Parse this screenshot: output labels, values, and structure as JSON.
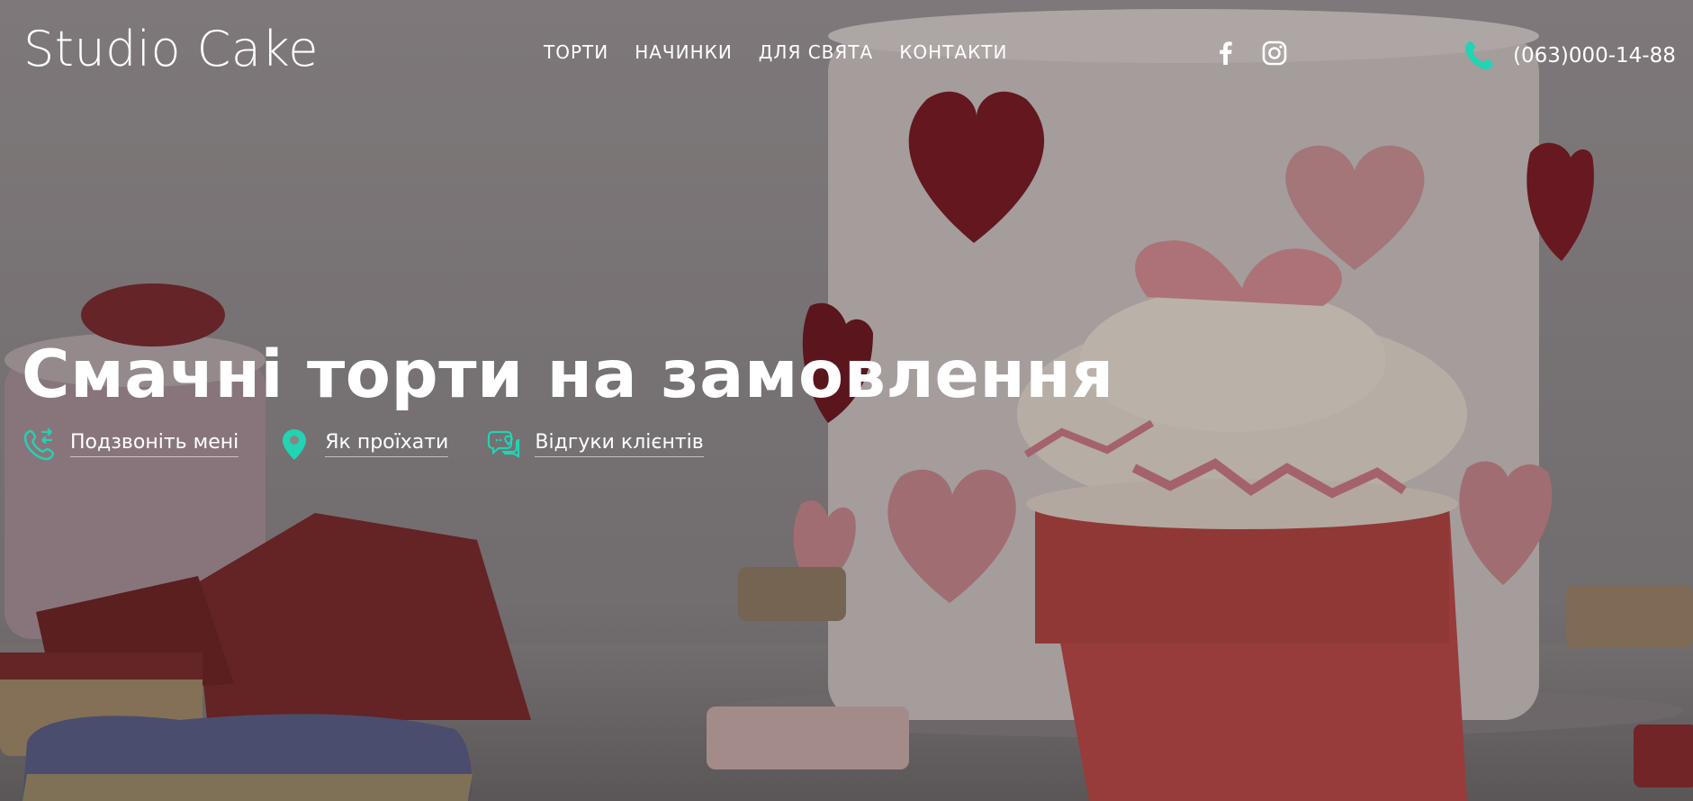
{
  "brand": {
    "logo_text": "Studio Cake"
  },
  "nav": {
    "items": [
      {
        "label": "ТОРТИ"
      },
      {
        "label": "НАЧИНКИ"
      },
      {
        "label": "ДЛЯ СВЯТА"
      },
      {
        "label": "КОНТАКТИ"
      }
    ]
  },
  "social": {
    "icons": [
      "facebook-icon",
      "instagram-icon"
    ]
  },
  "contact": {
    "phone": "(063)000-14-88",
    "icon": "phone-icon"
  },
  "hero": {
    "title": "Смачні торти на замовлення",
    "actions": [
      {
        "label": "Подзвоніть мені",
        "icon": "phone-callback-icon"
      },
      {
        "label": "Як проїхати",
        "icon": "map-pin-icon"
      },
      {
        "label": "Відгуки клієнтів",
        "icon": "chat-heart-icon"
      }
    ]
  },
  "colors": {
    "accent": "#22d3b4",
    "text": "#ffffff"
  }
}
